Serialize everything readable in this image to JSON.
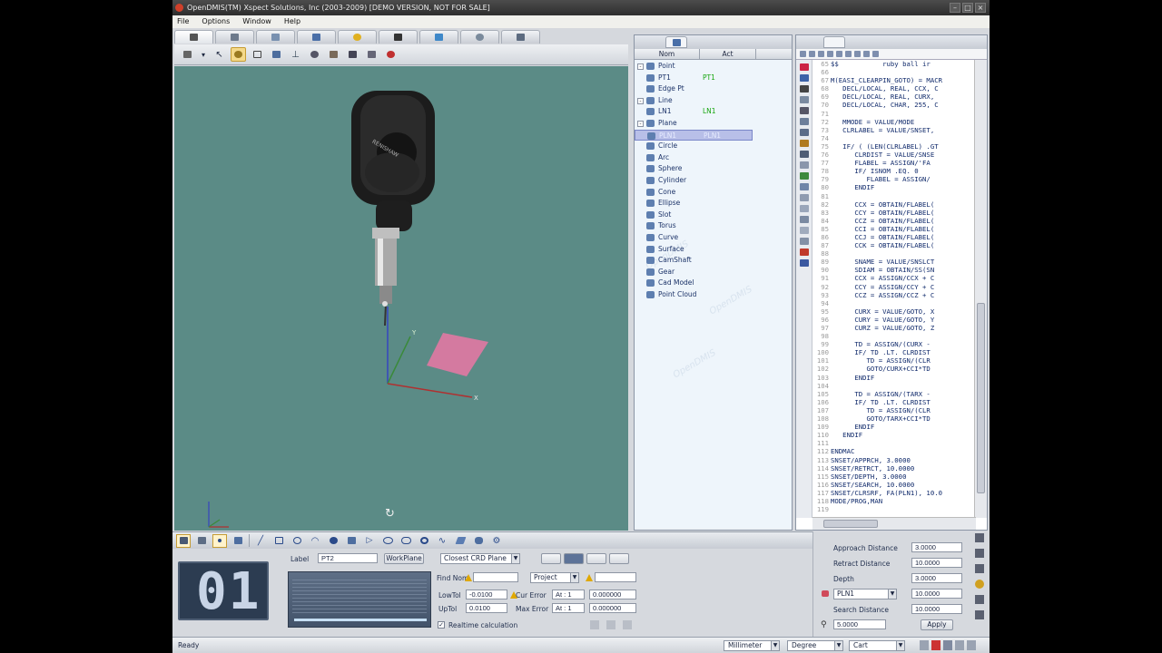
{
  "window": {
    "title": "OpenDMIS(TM)  Xspect Solutions, Inc  (2003-2009) [DEMO VERSION, NOT FOR SALE]"
  },
  "menu": [
    "File",
    "Options",
    "Window",
    "Help"
  ],
  "viewport": {
    "probe_brand": "RENISHAW",
    "axis_x": "X",
    "axis_y": "Y"
  },
  "feature_panel": {
    "col_name": "Nom",
    "col_act": "Act",
    "rows": [
      {
        "name": "Point",
        "act": "",
        "icon": "point-icon",
        "tree": "-"
      },
      {
        "name": "PT1",
        "act": "PT1",
        "icon": "point-icon"
      },
      {
        "name": "Edge Pt",
        "act": "",
        "icon": "edge-point-icon"
      },
      {
        "name": "Line",
        "act": "",
        "icon": "line-icon",
        "tree": "-"
      },
      {
        "name": "LN1",
        "act": "LN1",
        "icon": "line-icon"
      },
      {
        "name": "Plane",
        "act": "",
        "icon": "plane-icon",
        "tree": "-"
      },
      {
        "name": "PLN1",
        "act": "PLN1",
        "icon": "plane-icon",
        "selected": true
      },
      {
        "name": "Circle",
        "act": "",
        "icon": "circle-icon"
      },
      {
        "name": "Arc",
        "act": "",
        "icon": "arc-icon"
      },
      {
        "name": "Sphere",
        "act": "",
        "icon": "sphere-icon"
      },
      {
        "name": "Cylinder",
        "act": "",
        "icon": "cylinder-icon"
      },
      {
        "name": "Cone",
        "act": "",
        "icon": "cone-icon"
      },
      {
        "name": "Ellipse",
        "act": "",
        "icon": "ellipse-icon"
      },
      {
        "name": "Slot",
        "act": "",
        "icon": "slot-icon"
      },
      {
        "name": "Torus",
        "act": "",
        "icon": "torus-icon"
      },
      {
        "name": "Curve",
        "act": "",
        "icon": "curve-icon"
      },
      {
        "name": "Surface",
        "act": "",
        "icon": "surface-icon"
      },
      {
        "name": "CamShaft",
        "act": "",
        "icon": "camshaft-icon"
      },
      {
        "name": "Gear",
        "act": "",
        "icon": "gear-icon"
      },
      {
        "name": "Cad Model",
        "act": "",
        "icon": "cad-model-icon"
      },
      {
        "name": "Point Cloud",
        "act": "",
        "icon": "point-cloud-icon"
      }
    ]
  },
  "editor": {
    "lines": [
      {
        "n": "65",
        "t": "$$           ruby ball ir"
      },
      {
        "n": "66",
        "t": ""
      },
      {
        "n": "67",
        "t": "M(EASI_CLEARPIN_GOTO) = MACR"
      },
      {
        "n": "68",
        "t": "   DECL/LOCAL, REAL, CCX, C"
      },
      {
        "n": "69",
        "t": "   DECL/LOCAL, REAL, CURX,"
      },
      {
        "n": "70",
        "t": "   DECL/LOCAL, CHAR, 255, C"
      },
      {
        "n": "71",
        "t": ""
      },
      {
        "n": "72",
        "t": "   MMODE = VALUE/MODE"
      },
      {
        "n": "73",
        "t": "   CLRLABEL = VALUE/SNSET,"
      },
      {
        "n": "74",
        "t": ""
      },
      {
        "n": "75",
        "t": "   IF/ ( (LEN(CLRLABEL) .GT"
      },
      {
        "n": "76",
        "t": "      CLRDIST = VALUE/SNSE"
      },
      {
        "n": "77",
        "t": "      FLABEL = ASSIGN/'FA"
      },
      {
        "n": "78",
        "t": "      IF/ ISNOM .EQ. 0"
      },
      {
        "n": "79",
        "t": "         FLABEL = ASSIGN/"
      },
      {
        "n": "80",
        "t": "      ENDIF"
      },
      {
        "n": "81",
        "t": ""
      },
      {
        "n": "82",
        "t": "      CCX = OBTAIN/FLABEL("
      },
      {
        "n": "83",
        "t": "      CCY = OBTAIN/FLABEL("
      },
      {
        "n": "84",
        "t": "      CCZ = OBTAIN/FLABEL("
      },
      {
        "n": "85",
        "t": "      CCI = OBTAIN/FLABEL("
      },
      {
        "n": "86",
        "t": "      CCJ = OBTAIN/FLABEL("
      },
      {
        "n": "87",
        "t": "      CCK = OBTAIN/FLABEL("
      },
      {
        "n": "88",
        "t": ""
      },
      {
        "n": "89",
        "t": "      SNAME = VALUE/SNSLCT"
      },
      {
        "n": "90",
        "t": "      SDIAM = OBTAIN/SS(SN"
      },
      {
        "n": "91",
        "t": "      CCX = ASSIGN/CCX + C"
      },
      {
        "n": "92",
        "t": "      CCY = ASSIGN/CCY + C"
      },
      {
        "n": "93",
        "t": "      CCZ = ASSIGN/CCZ + C"
      },
      {
        "n": "94",
        "t": ""
      },
      {
        "n": "95",
        "t": "      CURX = VALUE/GOTO, X"
      },
      {
        "n": "96",
        "t": "      CURY = VALUE/GOTO, Y"
      },
      {
        "n": "97",
        "t": "      CURZ = VALUE/GOTO, Z"
      },
      {
        "n": "98",
        "t": ""
      },
      {
        "n": "99",
        "t": "      TD = ASSIGN/(CURX -"
      },
      {
        "n": "100",
        "t": "      IF/ TD .LT. CLRDIST"
      },
      {
        "n": "101",
        "t": "         TD = ASSIGN/(CLR"
      },
      {
        "n": "102",
        "t": "         GOTO/CURX+CCI*TD"
      },
      {
        "n": "103",
        "t": "      ENDIF"
      },
      {
        "n": "104",
        "t": ""
      },
      {
        "n": "105",
        "t": "      TD = ASSIGN/(TARX -"
      },
      {
        "n": "106",
        "t": "      IF/ TD .LT. CLRDIST"
      },
      {
        "n": "107",
        "t": "         TD = ASSIGN/(CLR"
      },
      {
        "n": "108",
        "t": "         GOTO/TARX+CCI*TD"
      },
      {
        "n": "109",
        "t": "      ENDIF"
      },
      {
        "n": "110",
        "t": "   ENDIF"
      },
      {
        "n": "111",
        "t": ""
      },
      {
        "n": "112",
        "t": "ENDMAC"
      },
      {
        "n": "113",
        "t": "SNSET/APPRCH, 3.0000"
      },
      {
        "n": "114",
        "t": "SNSET/RETRCT, 10.0000"
      },
      {
        "n": "115",
        "t": "SNSET/DEPTH, 3.0000"
      },
      {
        "n": "116",
        "t": "SNSET/SEARCH, 10.0000"
      },
      {
        "n": "117",
        "t": "SNSET/CLRSRF, FA(PLN1), 10.0"
      },
      {
        "n": "118",
        "t": "MODE/PROG,MAN"
      },
      {
        "n": "119",
        "t": ""
      }
    ]
  },
  "bottom": {
    "counter": "01",
    "label_caption": "Label",
    "label_value": "PT2",
    "workplane_button": "WorkPlane",
    "projection_select": "Closest CRD Plane",
    "find_nom_caption": "Find Nom",
    "find_nom_select": "Project",
    "lowtol_caption": "LowTol",
    "lowtol_value": "-0.0100",
    "uptol_caption": "UpTol",
    "uptol_value": "0.0100",
    "cur_error_caption": "Cur Error",
    "max_error_caption": "Max Error",
    "cur_error_at": "At : 1",
    "max_error_at": "At : 1",
    "cur_error_value": "0.000000",
    "max_error_value": "0.000000",
    "realtime_label": "Realtime calculation",
    "realtime_checked": true
  },
  "probe": {
    "approach_label": "Approach Distance",
    "approach_value": "3.0000",
    "retract_label": "Retract Distance",
    "retract_value": "10.0000",
    "depth_label": "Depth",
    "depth_value": "3.0000",
    "clear_plane_select": "PLN1",
    "clear_plane_value": "10.0000",
    "search_label": "Search Distance",
    "search_value": "10.0000",
    "speed_value": "5.0000",
    "apply_button": "Apply"
  },
  "status": {
    "text": "Ready",
    "units": "Millimeter",
    "angle": "Degree",
    "coord": "Cart"
  },
  "colors": {
    "viewport_bg": "#5b8b86",
    "plane_fill": "#d47aa0",
    "active_line": "#19a33a",
    "selected_row": "#b8bfe8"
  }
}
